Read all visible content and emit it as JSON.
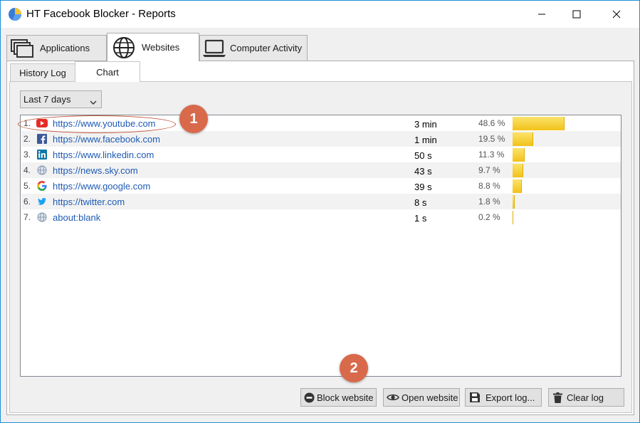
{
  "window": {
    "title": "HT Facebook Blocker - Reports"
  },
  "top_tabs": [
    {
      "label": "Applications",
      "icon": "windows-icon"
    },
    {
      "label": "Websites",
      "icon": "globe-icon"
    },
    {
      "label": "Computer Activity",
      "icon": "laptop-icon"
    }
  ],
  "sub_tabs": [
    {
      "label": "History Log"
    },
    {
      "label": "Chart"
    }
  ],
  "filter": {
    "selected": "Last 7 days"
  },
  "rows": [
    {
      "num": "1.",
      "icon": "youtube-icon",
      "url": "https://www.youtube.com",
      "duration": "3 min",
      "percent": "48.6 %",
      "share": 48.6
    },
    {
      "num": "2.",
      "icon": "facebook-icon",
      "url": "https://www.facebook.com",
      "duration": "1 min",
      "percent": "19.5 %",
      "share": 19.5
    },
    {
      "num": "3.",
      "icon": "linkedin-icon",
      "url": "https://www.linkedin.com",
      "duration": "50 s",
      "percent": "11.3 %",
      "share": 11.3
    },
    {
      "num": "4.",
      "icon": "globe-icon",
      "url": "https://news.sky.com",
      "duration": "43 s",
      "percent": "9.7 %",
      "share": 9.7
    },
    {
      "num": "5.",
      "icon": "google-icon",
      "url": "https://www.google.com",
      "duration": "39 s",
      "percent": "8.8 %",
      "share": 8.8
    },
    {
      "num": "6.",
      "icon": "twitter-icon",
      "url": "https://twitter.com",
      "duration": "8 s",
      "percent": "1.8 %",
      "share": 1.8
    },
    {
      "num": "7.",
      "icon": "globe-icon",
      "url": "about:blank",
      "duration": "1 s",
      "percent": "0.2 %",
      "share": 0.2
    }
  ],
  "buttons": {
    "block": "Block website",
    "open": "Open website",
    "export": "Export log...",
    "clear": "Clear log"
  },
  "callouts": [
    "1",
    "2"
  ],
  "colors": {
    "accent_border": "#1e8fd8",
    "link": "#1e5bb4",
    "bar": "#f2c21a",
    "callout": "#d9694b"
  }
}
